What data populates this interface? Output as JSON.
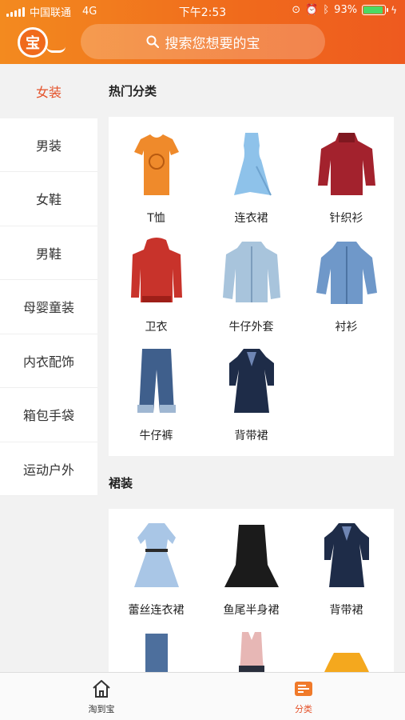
{
  "status_bar": {
    "carrier": "中国联通",
    "network": "4G",
    "time": "下午2:53",
    "battery": "93%",
    "battery_level": 0.93
  },
  "header": {
    "logo_text": "宝",
    "search_placeholder": "搜索您想要的宝"
  },
  "sidebar": {
    "items": [
      {
        "label": "女装",
        "active": true
      },
      {
        "label": "男装",
        "active": false
      },
      {
        "label": "女鞋",
        "active": false
      },
      {
        "label": "男鞋",
        "active": false
      },
      {
        "label": "母婴童装",
        "active": false
      },
      {
        "label": "内衣配饰",
        "active": false
      },
      {
        "label": "箱包手袋",
        "active": false
      },
      {
        "label": "运动户外",
        "active": false
      }
    ]
  },
  "sections": [
    {
      "title": "热门分类",
      "items": [
        {
          "label": "T恤",
          "icon": "tshirt-icon",
          "color": "#ef8a2b"
        },
        {
          "label": "连衣裙",
          "icon": "dress-icon",
          "color": "#8ec2ea"
        },
        {
          "label": "针织衫",
          "icon": "sweater-icon",
          "color": "#a3222d"
        },
        {
          "label": "卫衣",
          "icon": "hoodie-icon",
          "color": "#c8332b"
        },
        {
          "label": "牛仔外套",
          "icon": "denim-jacket-icon",
          "color": "#a8c4dc"
        },
        {
          "label": "衬衫",
          "icon": "shirt-icon",
          "color": "#6f98c9"
        },
        {
          "label": "牛仔裤",
          "icon": "jeans-icon",
          "color": "#3f5f8c"
        },
        {
          "label": "背带裙",
          "icon": "pinafore-icon",
          "color": "#1e2c48"
        }
      ]
    },
    {
      "title": "裙装",
      "items": [
        {
          "label": "蕾丝连衣裙",
          "icon": "lace-dress-icon",
          "color": "#a9c6e6"
        },
        {
          "label": "鱼尾半身裙",
          "icon": "mermaid-skirt-icon",
          "color": "#1b1b1b"
        },
        {
          "label": "背带裙",
          "icon": "pinafore-icon",
          "color": "#1e2c48"
        },
        {
          "label": "",
          "icon": "denim-skirt-icon",
          "color": "#4d6f9d"
        },
        {
          "label": "",
          "icon": "colorblock-dress-icon",
          "color": "#e7b7b5"
        },
        {
          "label": "",
          "icon": "yellow-skirt-icon",
          "color": "#f4a81e"
        }
      ]
    }
  ],
  "tabbar": {
    "items": [
      {
        "label": "淘到宝",
        "icon": "home-icon",
        "active": false
      },
      {
        "label": "分类",
        "icon": "category-icon",
        "active": true
      }
    ]
  },
  "colors": {
    "accent": "#e4522a",
    "header_start": "#f38a1f",
    "header_end": "#ee5a1f"
  }
}
